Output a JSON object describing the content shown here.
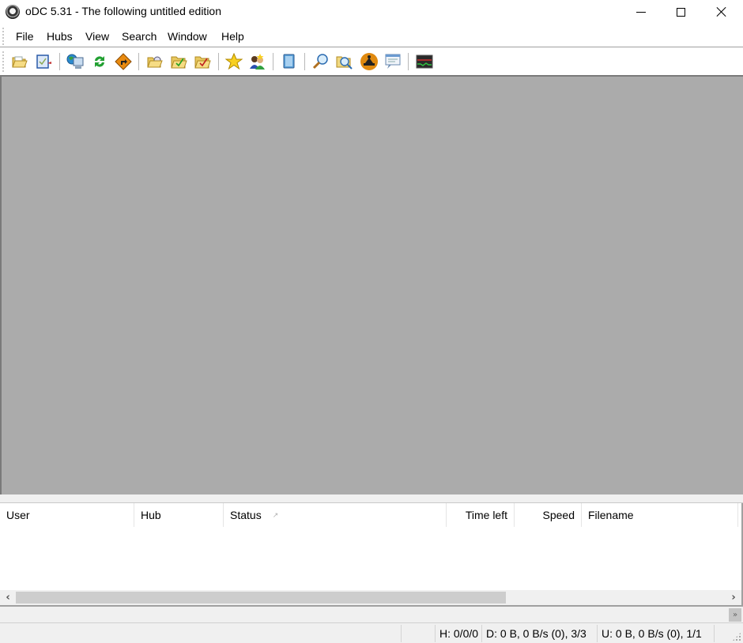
{
  "window": {
    "title": "oDC 5.31 - The following untitled edition",
    "app_icon": "odc-eye-icon",
    "controls": [
      "minimize",
      "maximize",
      "close"
    ]
  },
  "menu": {
    "items": [
      "File",
      "Hubs",
      "View",
      "Search",
      "Window",
      "Help"
    ]
  },
  "toolbar": {
    "buttons": [
      {
        "icon": "open-filelist-folder-icon",
        "tooltip": ""
      },
      {
        "icon": "open-own-list-icon",
        "tooltip": ""
      },
      {
        "icon": "public-hubs-network-icon",
        "tooltip": ""
      },
      {
        "icon": "reconnect-refresh-icon",
        "tooltip": ""
      },
      {
        "icon": "follow-redirect-sign-icon",
        "tooltip": ""
      },
      {
        "icon": "open-downloads-folder-icon",
        "tooltip": ""
      },
      {
        "icon": "finished-downloads-folder-icon",
        "tooltip": ""
      },
      {
        "icon": "finished-uploads-folder-icon",
        "tooltip": ""
      },
      {
        "icon": "favorite-hubs-star-icon",
        "tooltip": ""
      },
      {
        "icon": "favorite-users-icon",
        "tooltip": ""
      },
      {
        "icon": "queue-notepad-icon",
        "tooltip": ""
      },
      {
        "icon": "search-magnifier-icon",
        "tooltip": ""
      },
      {
        "icon": "search-spy-folder-icon",
        "tooltip": ""
      },
      {
        "icon": "adl-search-icon",
        "tooltip": ""
      },
      {
        "icon": "system-log-window-icon",
        "tooltip": ""
      },
      {
        "icon": "network-stats-graph-icon",
        "tooltip": ""
      }
    ]
  },
  "transfers": {
    "columns": [
      {
        "label": "User"
      },
      {
        "label": "Hub"
      },
      {
        "label": "Status",
        "sort_indicator": "↗"
      },
      {
        "label": "Time left"
      },
      {
        "label": "Speed"
      },
      {
        "label": "Filename"
      }
    ],
    "rows": [],
    "scroll_left": "‹",
    "scroll_right": "›"
  },
  "chevron": "»",
  "statusbar": {
    "panes": [
      "",
      "",
      "H: 0/0/0",
      "D: 0 B, 0 B/s (0), 3/3",
      "U: 0 B, 0 B/s (0), 1/1",
      ""
    ]
  }
}
